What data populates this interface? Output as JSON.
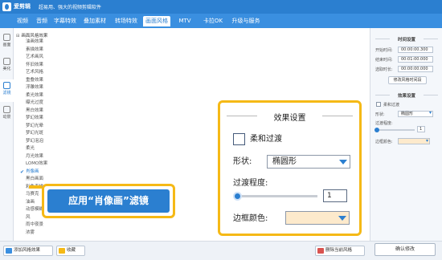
{
  "app": {
    "name": "爱剪辑",
    "slogan": "超易用、强大的视频剪辑软件"
  },
  "tabs": [
    {
      "label": "视频",
      "active": false
    },
    {
      "label": "音频",
      "active": false
    },
    {
      "label": "字幕特效",
      "active": false
    },
    {
      "label": "叠加素材",
      "active": false
    },
    {
      "label": "转场特效",
      "active": false
    },
    {
      "label": "画面风格",
      "active": true
    },
    {
      "label": "MTV",
      "active": false
    },
    {
      "label": "卡拉OK",
      "active": false
    },
    {
      "label": "升级与服务",
      "active": false
    }
  ],
  "left_strip": [
    {
      "label": "画面",
      "icon": "picture-icon",
      "active": false
    },
    {
      "label": "美化",
      "icon": "brush-icon",
      "active": false
    },
    {
      "label": "滤镜",
      "icon": "filter-icon",
      "active": true
    },
    {
      "label": "动景",
      "icon": "motion-icon",
      "active": false
    }
  ],
  "tree": {
    "root": "画面风格效果",
    "items": [
      {
        "label": "油画效果",
        "checked": false
      },
      {
        "label": "素描效果",
        "checked": false
      },
      {
        "label": "艺术画风",
        "checked": false
      },
      {
        "label": "怀旧效果",
        "checked": false
      },
      {
        "label": "艺术风格",
        "checked": false
      },
      {
        "label": "重叠效果",
        "checked": false
      },
      {
        "label": "浮雕效果",
        "checked": false
      },
      {
        "label": "柔光效果",
        "checked": false
      },
      {
        "label": "曝光过度",
        "checked": false
      },
      {
        "label": "黑白效果",
        "checked": false
      },
      {
        "label": "梦幻效果",
        "checked": false
      },
      {
        "label": "梦幻光晕",
        "checked": false
      },
      {
        "label": "梦幻光斑",
        "checked": false
      },
      {
        "label": "梦幻泡泡",
        "checked": false
      },
      {
        "label": "柔光",
        "checked": false
      },
      {
        "label": "月光效果",
        "checked": false
      },
      {
        "label": "LOMO效果",
        "checked": false
      },
      {
        "label": "肖像画",
        "checked": true
      },
      {
        "label": "黑白画面",
        "checked": false
      },
      {
        "label": "彩色素描",
        "checked": false
      },
      {
        "label": "马赛克",
        "checked": false
      },
      {
        "label": "油画",
        "checked": false
      },
      {
        "label": "动感模糊",
        "checked": false
      },
      {
        "label": "风",
        "checked": false
      },
      {
        "label": "雨中夜景",
        "checked": false
      },
      {
        "label": "浓雾",
        "checked": false
      }
    ]
  },
  "bottom_bar": {
    "add_effect": "添加风格效果",
    "favorite": "收藏",
    "delete_effect": "删除当前风格"
  },
  "right_panel": {
    "time_header": "时间设置",
    "start_label": "开始时间:",
    "start_value": "00:00:00.300",
    "end_label": "结束时间:",
    "end_value": "00:01:00.000",
    "duration_label": "选取时长:",
    "duration_value": "00:00:00.000",
    "modify_time_button": "修改风格时间段",
    "effect_header": "效果设置",
    "soft_transition": "柔和过渡",
    "shape_label": "形状:",
    "shape_value": "椭圆形",
    "degree_label": "过渡程度:",
    "degree_value": "1",
    "border_label": "边框颜色:",
    "confirm_button": "确认修改"
  },
  "callout": {
    "title": "效果设置",
    "soft_transition": "柔和过渡",
    "soft_transition_checked": false,
    "shape_label": "形状:",
    "shape_value": "椭圆形",
    "degree_label": "过渡程度:",
    "degree_value": "1",
    "border_label": "边框颜色:",
    "border_color": "#fdeacc"
  },
  "apply_callout": {
    "text": "应用“肖像画”滤镜"
  },
  "colors": {
    "brand": "#2b7fd0",
    "highlight": "#f5b916"
  }
}
